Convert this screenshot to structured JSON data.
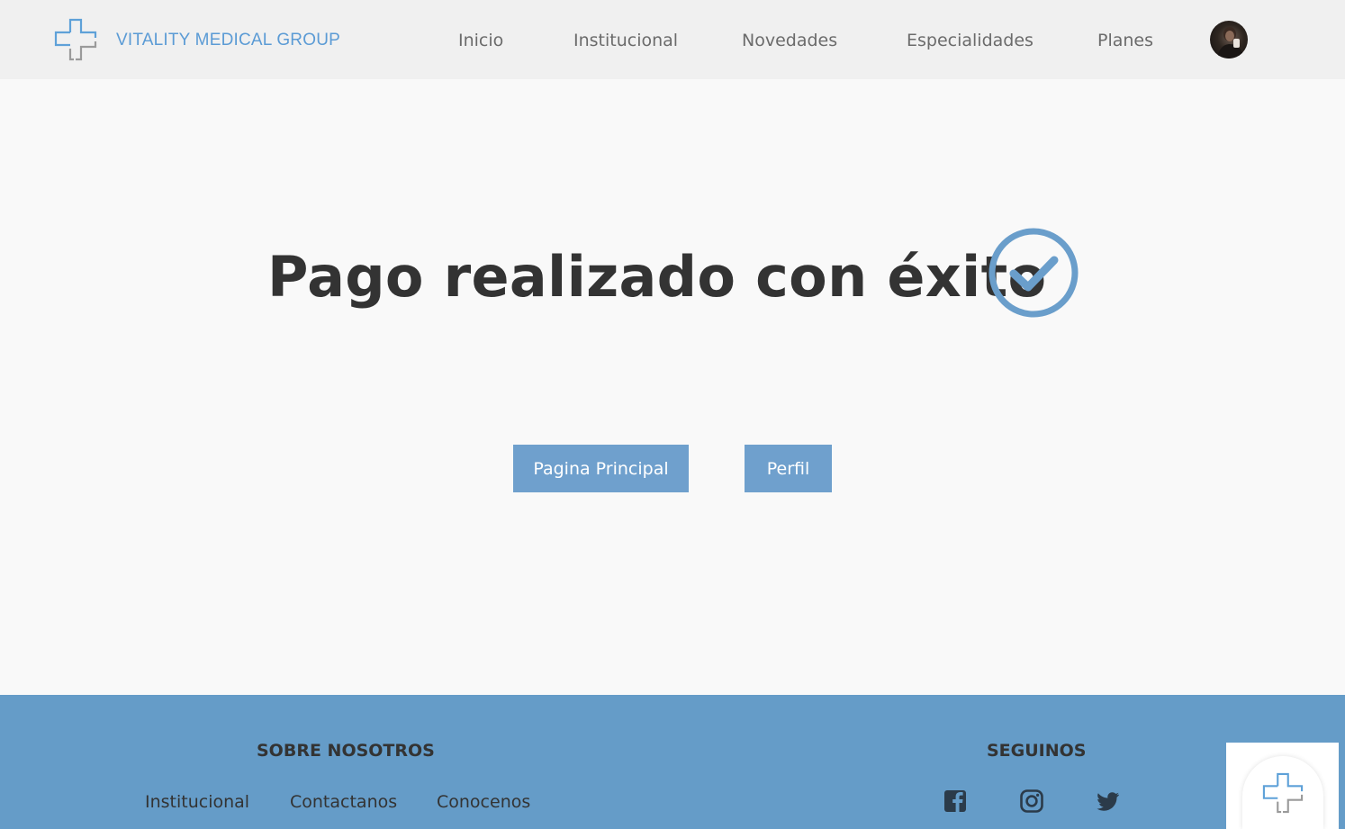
{
  "header": {
    "brand": "VITALITY MEDICAL GROUP",
    "nav": [
      {
        "label": "Inicio"
      },
      {
        "label": "Institucional"
      },
      {
        "label": "Novedades"
      },
      {
        "label": "Especialidades"
      },
      {
        "label": "Planes"
      }
    ]
  },
  "main": {
    "title": "Pago realizado con éxito",
    "buttons": {
      "home": "Pagina Principal",
      "profile": "Perfil"
    }
  },
  "footer": {
    "about_heading": "SOBRE NOSOTROS",
    "links": [
      "Institucional",
      "Contactanos",
      "Conocenos"
    ],
    "social_heading": "SEGUINOS",
    "social": [
      "facebook-icon",
      "instagram-icon",
      "twitter-icon"
    ]
  },
  "colors": {
    "brand": "#5b9bd5",
    "accent": "#6fa0cd",
    "footer_bg": "#659cc8",
    "title": "#333333"
  }
}
